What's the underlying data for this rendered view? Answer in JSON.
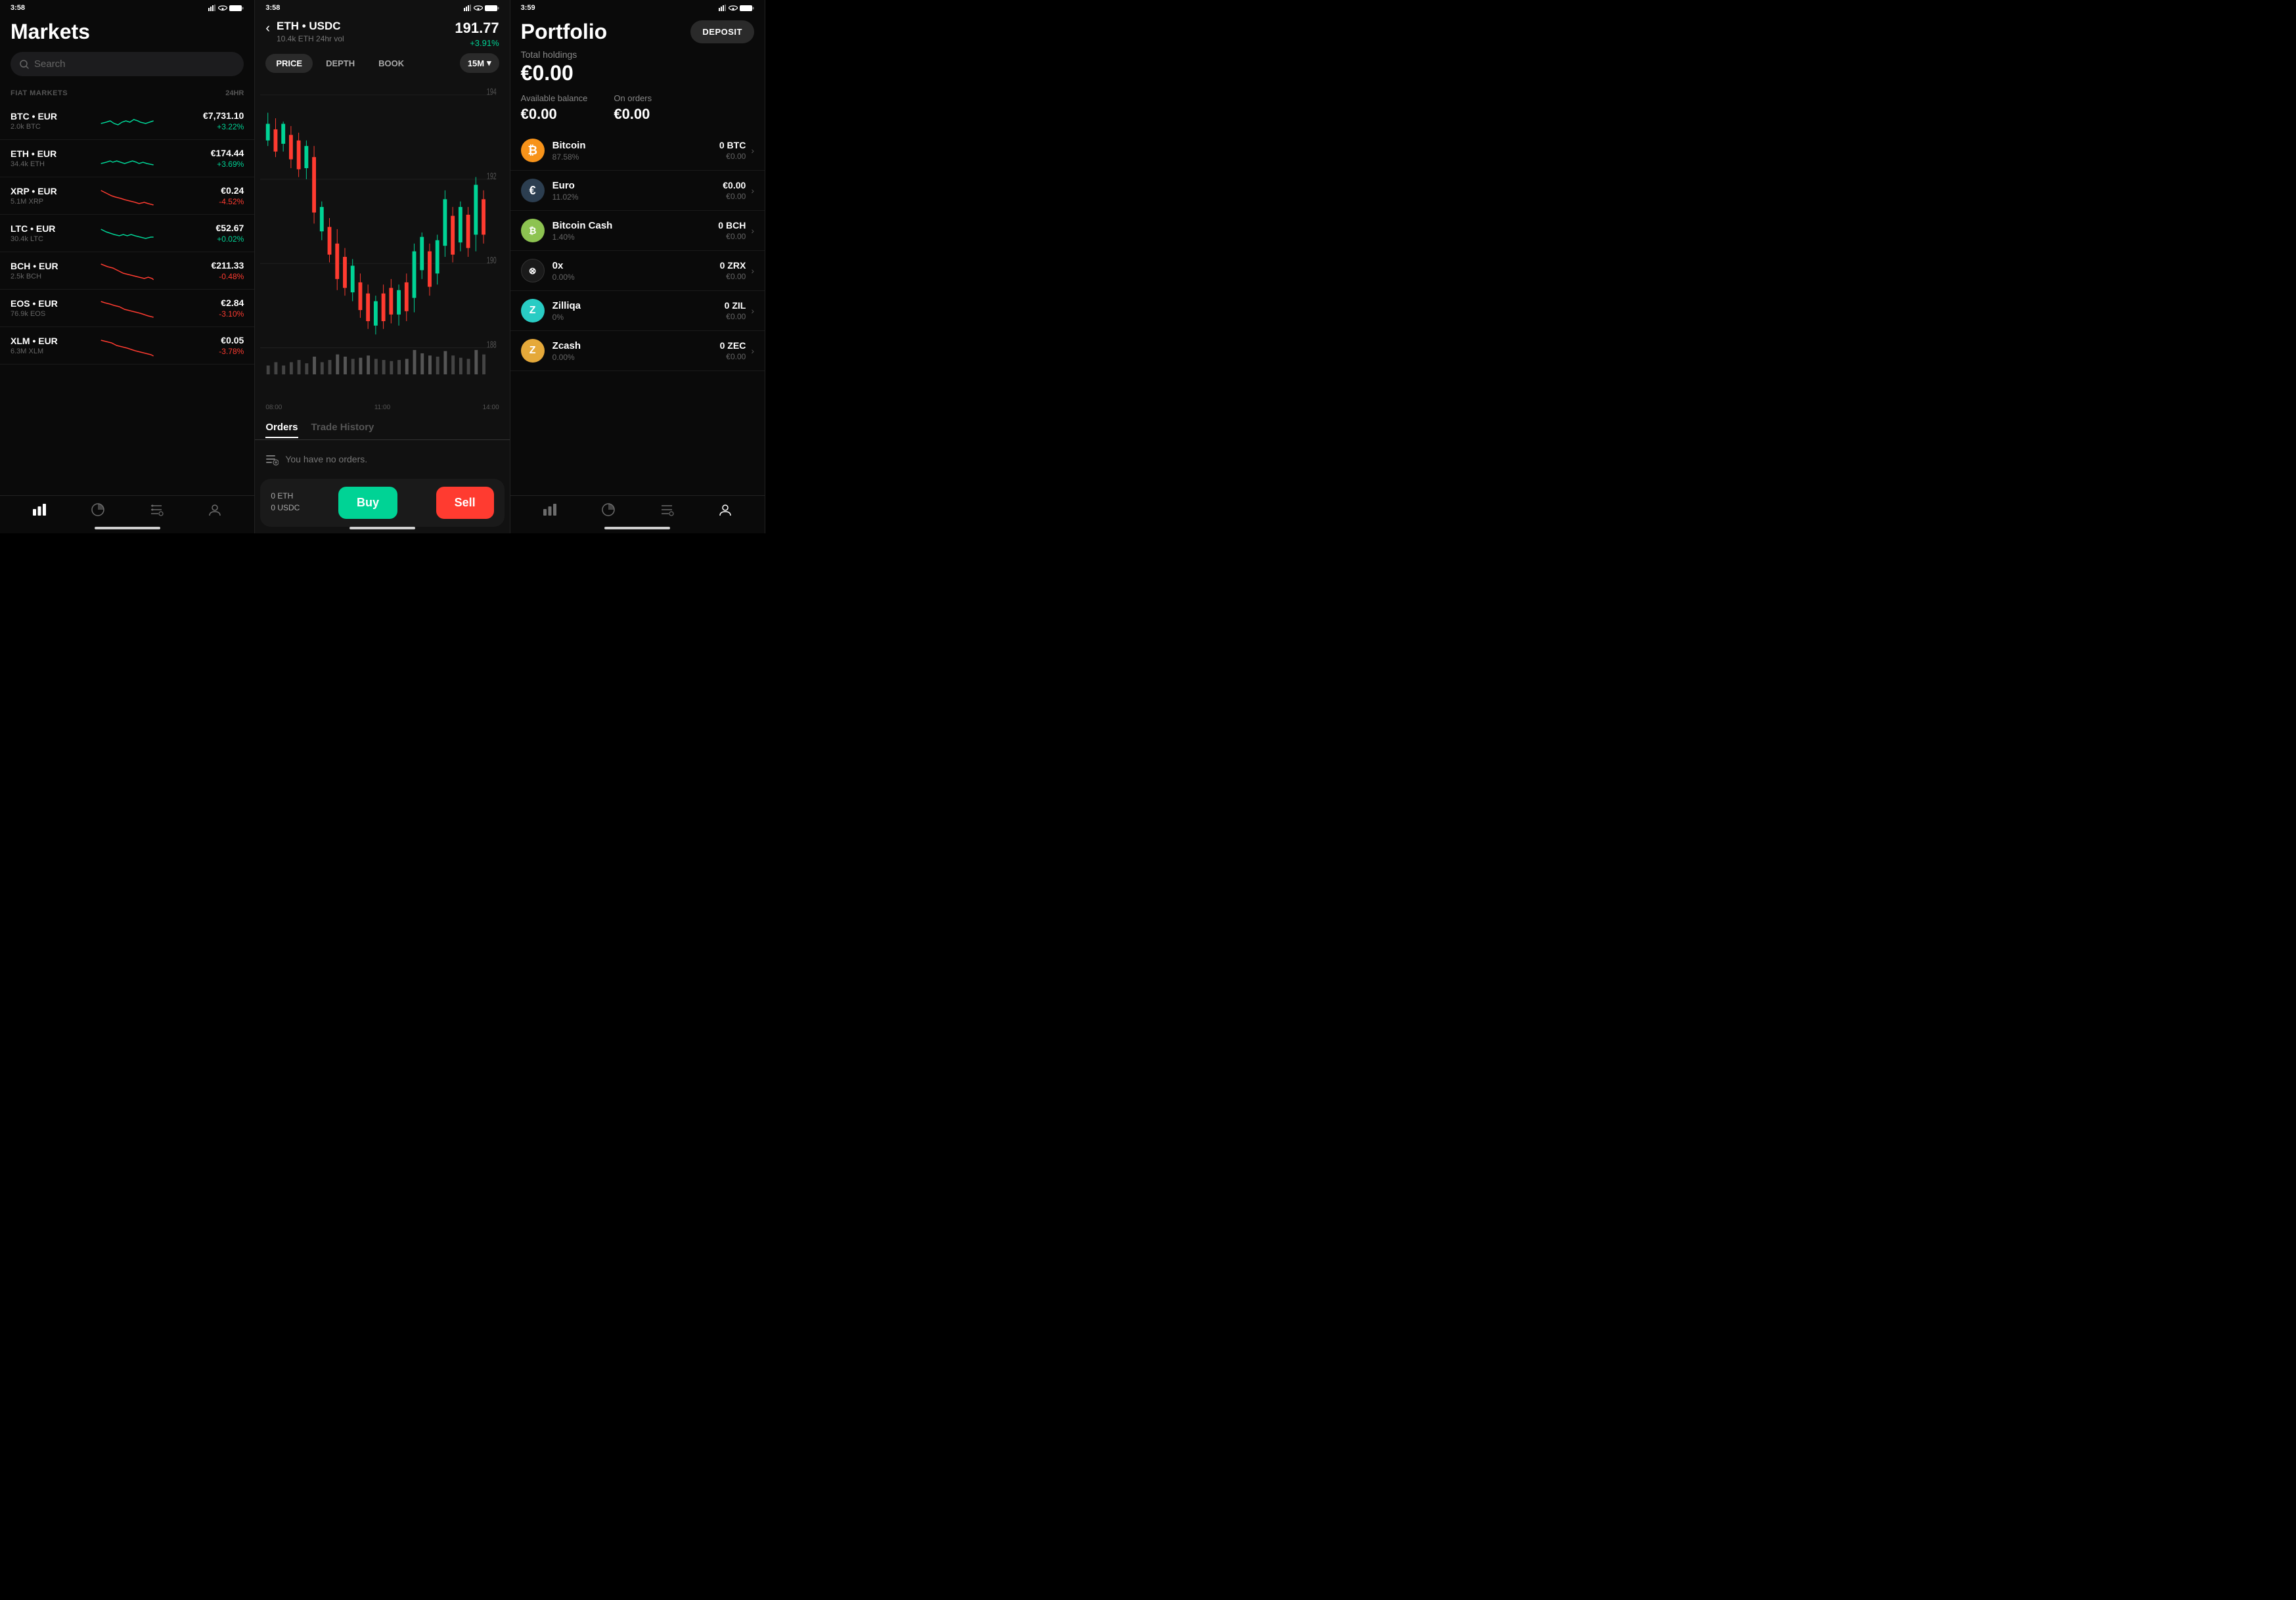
{
  "panel1": {
    "status": {
      "time": "3:58",
      "location": true
    },
    "title": "Markets",
    "search": {
      "placeholder": "Search"
    },
    "section": {
      "label": "FIAT MARKETS",
      "col2": "24HR"
    },
    "markets": [
      {
        "pair": "BTC • EUR",
        "vol": "2.0k BTC",
        "price": "€7,731.10",
        "change": "+3.22%",
        "positive": true
      },
      {
        "pair": "ETH • EUR",
        "vol": "34.4k ETH",
        "price": "€174.44",
        "change": "+3.69%",
        "positive": true
      },
      {
        "pair": "XRP • EUR",
        "vol": "5.1M XRP",
        "price": "€0.24",
        "change": "-4.52%",
        "positive": false
      },
      {
        "pair": "LTC • EUR",
        "vol": "30.4k LTC",
        "price": "€52.67",
        "change": "+0.02%",
        "positive": true
      },
      {
        "pair": "BCH • EUR",
        "vol": "2.5k BCH",
        "price": "€211.33",
        "change": "-0.48%",
        "positive": false
      },
      {
        "pair": "EOS • EUR",
        "vol": "76.9k EOS",
        "price": "€2.84",
        "change": "-3.10%",
        "positive": false
      },
      {
        "pair": "XLM • EUR",
        "vol": "6.3M XLM",
        "price": "€0.05",
        "change": "-3.78%",
        "positive": false
      }
    ],
    "nav": [
      "chart-bar",
      "pie-chart",
      "list",
      "person"
    ]
  },
  "panel2": {
    "status": {
      "time": "3:58"
    },
    "pair": "ETH • USDC",
    "vol": "10.4k ETH 24hr vol",
    "price": "191.77",
    "change": "+3.91%",
    "tabs": [
      "PRICE",
      "DEPTH",
      "BOOK"
    ],
    "activeTab": "PRICE",
    "timeframe": "15M",
    "xLabels": [
      "08:00",
      "11:00",
      "14:00"
    ],
    "yLabels": [
      "194",
      "192",
      "190",
      "188"
    ],
    "orders": {
      "tab1": "Orders",
      "tab2": "Trade History",
      "noOrders": "You have no orders."
    },
    "tradeBalance": {
      "eth": "0 ETH",
      "usdc": "0 USDC"
    },
    "buyLabel": "Buy",
    "sellLabel": "Sell"
  },
  "panel3": {
    "status": {
      "time": "3:59"
    },
    "title": "Portfolio",
    "deposit": "DEPOSIT",
    "totalLabel": "Total holdings",
    "totalValue": "€0.00",
    "balances": [
      {
        "label": "Available balance",
        "value": "€0.00"
      },
      {
        "label": "On orders",
        "value": "€0.00"
      }
    ],
    "assets": [
      {
        "name": "Bitcoin",
        "pct": "87.58%",
        "crypto": "0 BTC",
        "eur": "€0.00",
        "iconClass": "btc",
        "iconText": "₿"
      },
      {
        "name": "Euro",
        "pct": "11.02%",
        "crypto": "€0.00",
        "eur": "€0.00",
        "iconClass": "eur",
        "iconText": "€"
      },
      {
        "name": "Bitcoin Cash",
        "pct": "1.40%",
        "crypto": "0 BCH",
        "eur": "€0.00",
        "iconClass": "bch",
        "iconText": "₿"
      },
      {
        "name": "0x",
        "pct": "0.00%",
        "crypto": "0 ZRX",
        "eur": "€0.00",
        "iconClass": "zrx",
        "iconText": "⊗"
      },
      {
        "name": "Zilliqa",
        "pct": "0%",
        "crypto": "0 ZIL",
        "eur": "€0.00",
        "iconClass": "zil",
        "iconText": "Z"
      },
      {
        "name": "Zcash",
        "pct": "0.00%",
        "crypto": "0 ZEC",
        "eur": "€0.00",
        "iconClass": "zec",
        "iconText": "ⓩ"
      }
    ],
    "nav": [
      "chart-bar",
      "pie-chart",
      "list",
      "person"
    ]
  }
}
